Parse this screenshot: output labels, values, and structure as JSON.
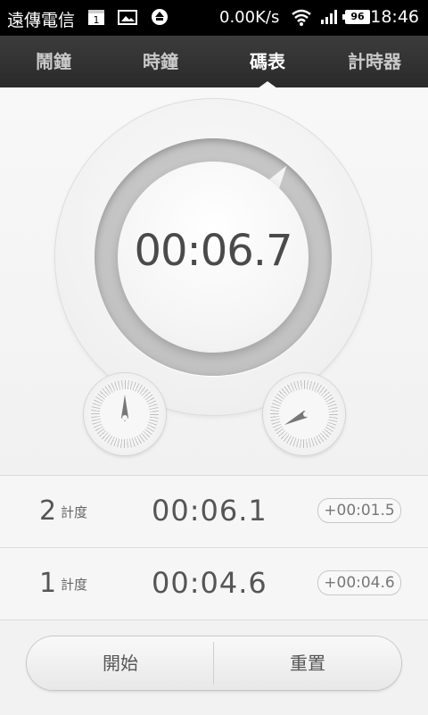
{
  "status_bar": {
    "carrier": "遠傳電信",
    "calendar_day": "1",
    "net_speed": "0.00K/s",
    "battery": "96",
    "time": "18:46"
  },
  "tabs": [
    {
      "label": "鬧鐘",
      "active": false
    },
    {
      "label": "時鐘",
      "active": false
    },
    {
      "label": "碼表",
      "active": true
    },
    {
      "label": "計時器",
      "active": false
    }
  ],
  "stopwatch": {
    "elapsed": "00:06.7"
  },
  "laps": [
    {
      "number": "2",
      "unit": "計度",
      "time": "00:06.1",
      "diff": "+00:01.5"
    },
    {
      "number": "1",
      "unit": "計度",
      "time": "00:04.6",
      "diff": "+00:04.6"
    }
  ],
  "buttons": {
    "start": "開始",
    "reset": "重置"
  },
  "icons": {
    "status": [
      "calendar-icon",
      "image-icon",
      "upload-icon",
      "wifi-icon",
      "signal-icon",
      "battery-icon"
    ],
    "dials": [
      "seconds-subdial-icon",
      "minutes-subdial-icon"
    ]
  },
  "colors": {
    "status_bar_bg": "#000000",
    "tab_bar_bg": "#333333",
    "text_primary": "#4a4a4a"
  }
}
